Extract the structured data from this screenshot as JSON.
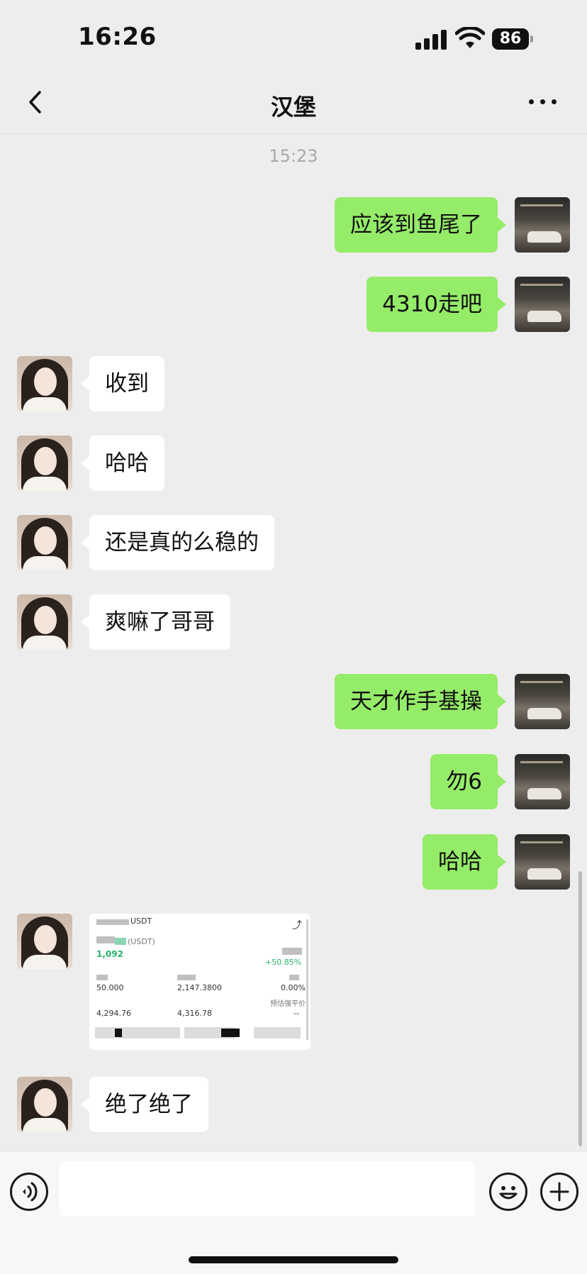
{
  "status_bar": {
    "time": "16:26",
    "battery": "86"
  },
  "header": {
    "title": "汉堡"
  },
  "timestamp": "15:23",
  "messages": [
    {
      "from": "self",
      "text": "应该到鱼尾了"
    },
    {
      "from": "self",
      "text": "4310走吧"
    },
    {
      "from": "other",
      "text": "收到"
    },
    {
      "from": "other",
      "text": "哈哈"
    },
    {
      "from": "other",
      "text": "还是真的么稳的"
    },
    {
      "from": "other",
      "text": "爽嘛了哥哥"
    },
    {
      "from": "self",
      "text": "天才作手基操"
    },
    {
      "from": "self",
      "text": "勿6"
    },
    {
      "from": "self",
      "text": "哈哈"
    },
    {
      "from": "other",
      "text": "绝了绝了"
    }
  ],
  "image_message": {
    "pair_suffix": "USDT",
    "unit": "(USDT)",
    "pnl": "1,092",
    "pnl_pct": "+50.85%",
    "row1": [
      "50.000",
      "2,147.3800",
      "0.00%"
    ],
    "row2": [
      "4,294.76",
      "4,316.78",
      "--"
    ],
    "liq_label": "预估强平价"
  }
}
